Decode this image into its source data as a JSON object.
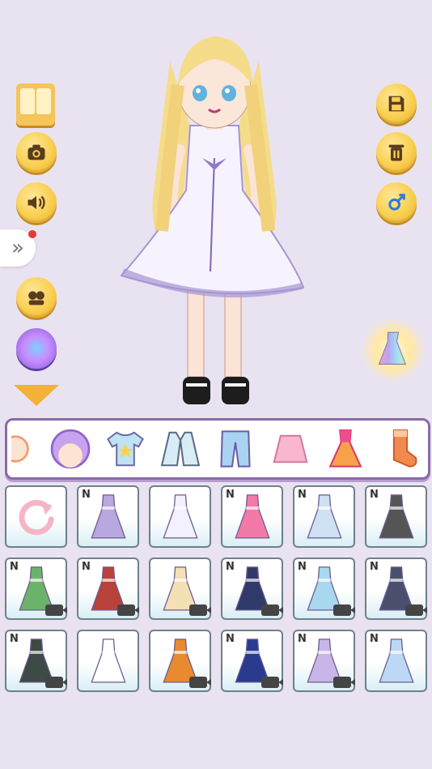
{
  "app": {
    "colors": {
      "background": "#e9e3f1",
      "gold": "#f9cf4f",
      "accent": "#8a6aa8"
    }
  },
  "left_toolbar": {
    "buttons": [
      "wardrobe-icon",
      "camera-icon",
      "sound-icon",
      "expand-icon",
      "friends-icon",
      "rainbow-orb-icon",
      "scroll-down-icon"
    ]
  },
  "right_toolbar": {
    "buttons": [
      "save-icon",
      "trash-icon",
      "gender-male-icon",
      "rainbow-dress-icon"
    ]
  },
  "category_tabs": [
    {
      "icon": "face-icon"
    },
    {
      "icon": "hair-icon"
    },
    {
      "icon": "tshirt-icon"
    },
    {
      "icon": "jacket-icon"
    },
    {
      "icon": "pants-icon"
    },
    {
      "icon": "skirt-icon"
    },
    {
      "icon": "dress-icon"
    },
    {
      "icon": "sock-icon"
    }
  ],
  "items": [
    {
      "type": "reset",
      "new": false,
      "video": false,
      "color": "#f4b6c6"
    },
    {
      "type": "dress",
      "new": true,
      "video": false,
      "color": "#b9a7e0",
      "badge": "N"
    },
    {
      "type": "dress",
      "new": false,
      "video": false,
      "color": "#f3f0ff"
    },
    {
      "type": "dress",
      "new": true,
      "video": false,
      "color": "#f27aa9",
      "badge": "N"
    },
    {
      "type": "dress",
      "new": true,
      "video": false,
      "color": "#cfe0f2",
      "badge": "N"
    },
    {
      "type": "dress",
      "new": true,
      "video": false,
      "color": "#555555",
      "badge": "N"
    },
    {
      "type": "dress",
      "new": true,
      "video": true,
      "color": "#6bb36a",
      "badge": "N"
    },
    {
      "type": "dress",
      "new": true,
      "video": true,
      "color": "#b8413a",
      "badge": "N"
    },
    {
      "type": "dress",
      "new": false,
      "video": true,
      "color": "#f3e0b5"
    },
    {
      "type": "dress",
      "new": true,
      "video": true,
      "color": "#2f3a6b",
      "badge": "N"
    },
    {
      "type": "dress",
      "new": true,
      "video": true,
      "color": "#a8d8f0",
      "badge": "N"
    },
    {
      "type": "dress",
      "new": true,
      "video": true,
      "color": "#4a4f6e",
      "badge": "N"
    },
    {
      "type": "dress",
      "new": true,
      "video": true,
      "color": "#3d4a45",
      "badge": "N"
    },
    {
      "type": "dress",
      "new": false,
      "video": false,
      "color": "#ffffff"
    },
    {
      "type": "dress",
      "new": false,
      "video": true,
      "color": "#e88a2f"
    },
    {
      "type": "dress",
      "new": true,
      "video": true,
      "color": "#2a3a8f",
      "badge": "N"
    },
    {
      "type": "dress",
      "new": true,
      "video": true,
      "color": "#c9b6e8",
      "badge": "N"
    },
    {
      "type": "dress",
      "new": true,
      "video": false,
      "color": "#bcd8f5",
      "badge": "N"
    }
  ]
}
